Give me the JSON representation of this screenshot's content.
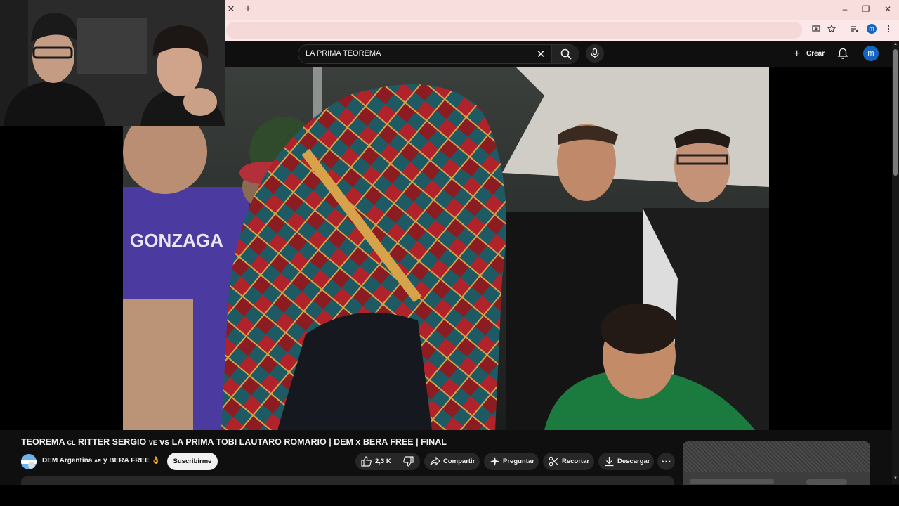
{
  "browser": {
    "tab_close": "✕",
    "new_tab": "+",
    "window": {
      "minimize": "–",
      "restore": "❐",
      "close": "✕"
    },
    "profile_letter": "m"
  },
  "header": {
    "search_query": "LA PRIMA TEOREMA",
    "create_label": "Crear",
    "avatar_letter": "m"
  },
  "video": {
    "title": "TEOREMA",
    "title_flag_cl": "CL",
    "title_part2": "RITTER SERGIO",
    "title_flag_ve": "VE",
    "title_part3": "vs LA PRIMA TOBI LAUTARO ROMARIO | DEM x BERA FREE | FINAL"
  },
  "channel": {
    "name": "DEM Argentina",
    "flag": "AR",
    "collab": "y BERA FREE",
    "emoji": "👌",
    "subscribe_label": "Suscribirme"
  },
  "actions": {
    "likes": "2,3 K",
    "share": "Compartir",
    "ask": "Preguntar",
    "clip": "Recortar",
    "download": "Descargar",
    "more": "⋯"
  },
  "colors": {
    "accent_blue": "#1565c0",
    "tab_strip": "#f9dede",
    "background": "#0f0f0f"
  }
}
